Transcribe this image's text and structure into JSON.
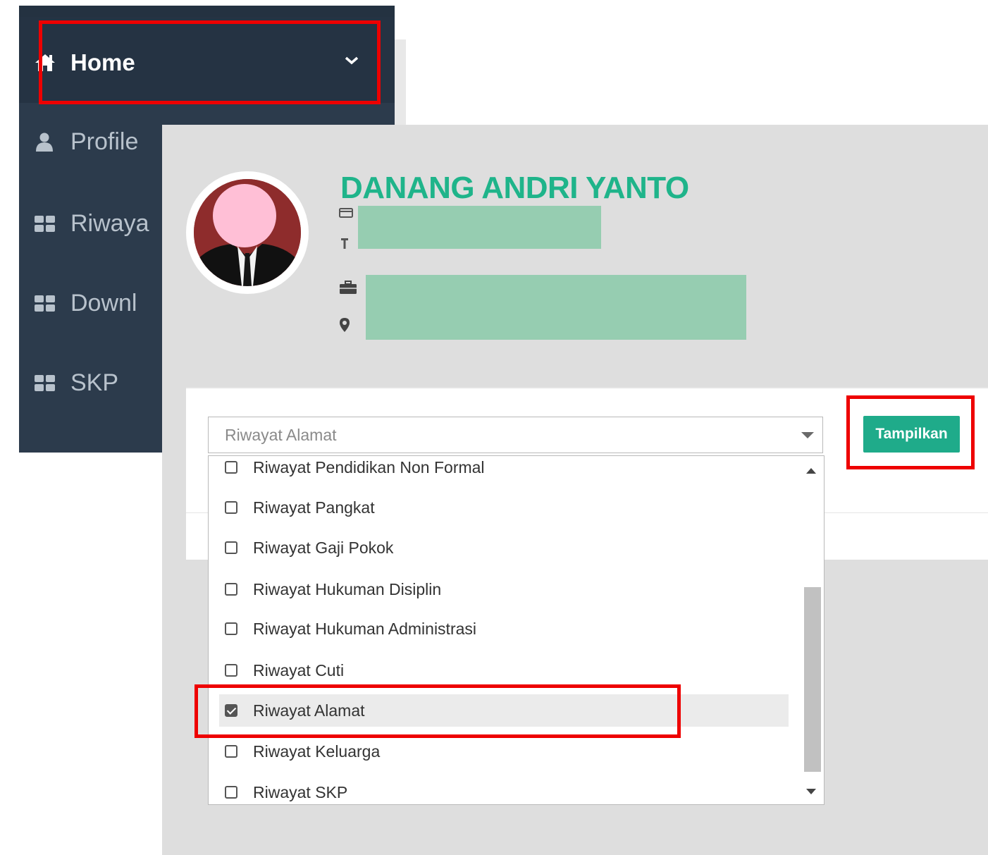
{
  "sidebar": {
    "items": [
      {
        "label": "Home",
        "icon": "home-icon"
      },
      {
        "label": "Profile",
        "icon": "user-icon"
      },
      {
        "label": "Riwaya",
        "icon": "grid-icon"
      },
      {
        "label": "Downl",
        "icon": "grid-icon"
      },
      {
        "label": "SKP",
        "icon": "grid-icon"
      }
    ]
  },
  "profile": {
    "name": "DANANG ANDRI YANTO"
  },
  "filter": {
    "selected_value": "Riwayat Alamat",
    "submit_label": "Tampilkan",
    "options": [
      {
        "label": "Riwayat Pendidikan Non Formal",
        "checked": false
      },
      {
        "label": "Riwayat Pangkat",
        "checked": false
      },
      {
        "label": "Riwayat Gaji Pokok",
        "checked": false
      },
      {
        "label": "Riwayat Hukuman Disiplin",
        "checked": false
      },
      {
        "label": "Riwayat Hukuman Administrasi",
        "checked": false
      },
      {
        "label": "Riwayat Cuti",
        "checked": false
      },
      {
        "label": "Riwayat Alamat",
        "checked": true
      },
      {
        "label": "Riwayat Keluarga",
        "checked": false
      },
      {
        "label": "Riwayat SKP",
        "checked": false
      }
    ]
  },
  "colors": {
    "sidebar_bg": "#2c3b4c",
    "accent_green": "#1fab8a",
    "name_green": "#1fb48a",
    "highlight_red": "#ee0000"
  }
}
